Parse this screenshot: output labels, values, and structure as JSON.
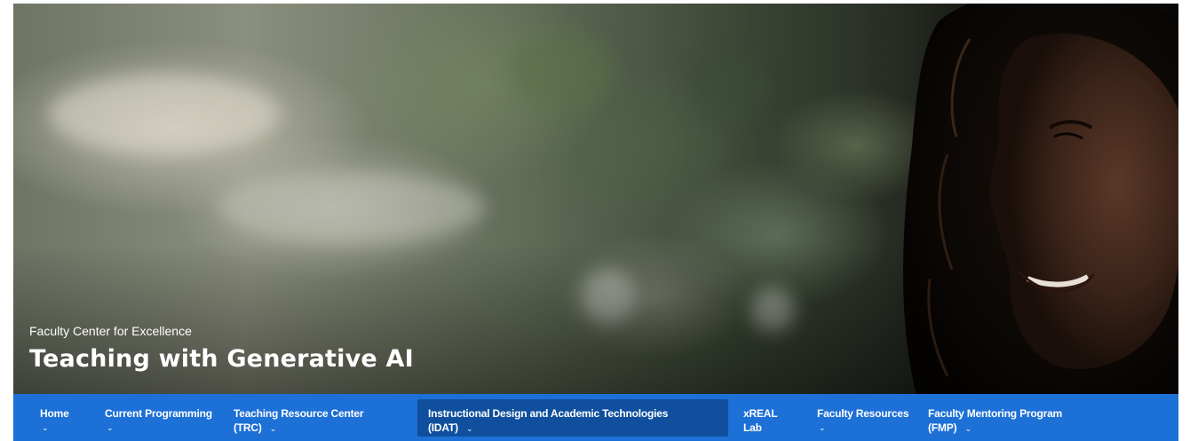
{
  "hero": {
    "eyebrow": "Faculty Center for Excellence",
    "title": "Teaching with Generative AI"
  },
  "nav": {
    "background": "#1d70d6",
    "active_background": "#0f4f9e",
    "caret_glyph": "⌄",
    "items": [
      {
        "line1": "Home",
        "line2": "",
        "dropdown": true
      },
      {
        "line1": "Current Programming",
        "line2": "",
        "dropdown": true
      },
      {
        "line1": "Teaching Resource Center",
        "line2": "(TRC)",
        "dropdown": true
      },
      {
        "line1": "Instructional Design and Academic Technologies",
        "line2": "(IDAT)",
        "dropdown": true,
        "active": true
      },
      {
        "line1": "xREAL",
        "line2": "Lab",
        "dropdown": false
      },
      {
        "line1": "Faculty Resources",
        "line2": "",
        "dropdown": true
      },
      {
        "line1": "Faculty Mentoring Program",
        "line2": "(FMP)",
        "dropdown": true
      }
    ]
  }
}
